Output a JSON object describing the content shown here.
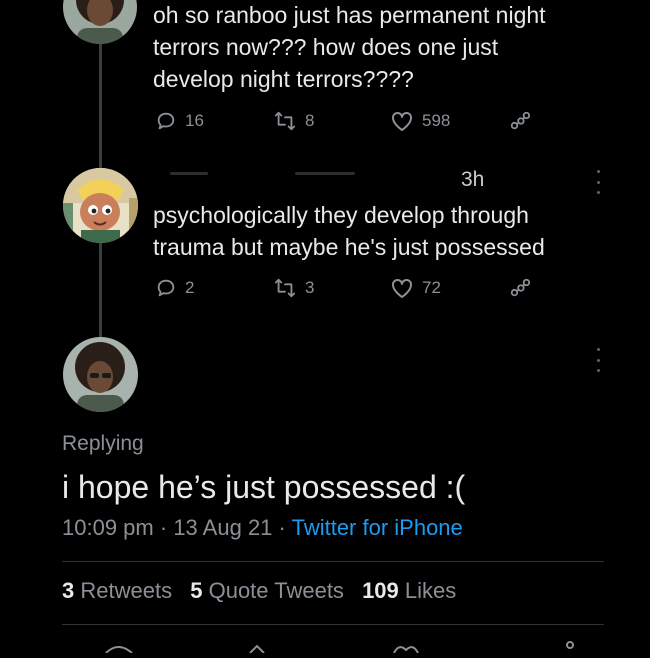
{
  "tweets": [
    {
      "text": "oh so ranboo just has permanent night\nterrors now??? how does one just\ndevelop night terrors????",
      "replies": "16",
      "retweets": "8",
      "likes": "598"
    },
    {
      "time": "3h",
      "text": "psychologically they develop through\ntrauma but maybe he's just possessed",
      "replies": "2",
      "retweets": "3",
      "likes": "72"
    }
  ],
  "main_tweet": {
    "replying_label": "Replying",
    "text": "i hope he’s just possessed :(",
    "time": "10:09 pm",
    "date": "13 Aug 21",
    "source": "Twitter for iPhone",
    "stats": {
      "retweets_count": "3",
      "retweets_label": "Retweets",
      "quotes_count": "5",
      "quotes_label": "Quote Tweets",
      "likes_count": "109",
      "likes_label": "Likes"
    }
  },
  "icons": [
    "reply-icon",
    "retweet-icon",
    "like-icon",
    "share-icon",
    "more-icon"
  ],
  "colors": {
    "background": "#000000",
    "text": "#e7e9ea",
    "muted": "#8b9097",
    "link": "#1d9bf0"
  }
}
